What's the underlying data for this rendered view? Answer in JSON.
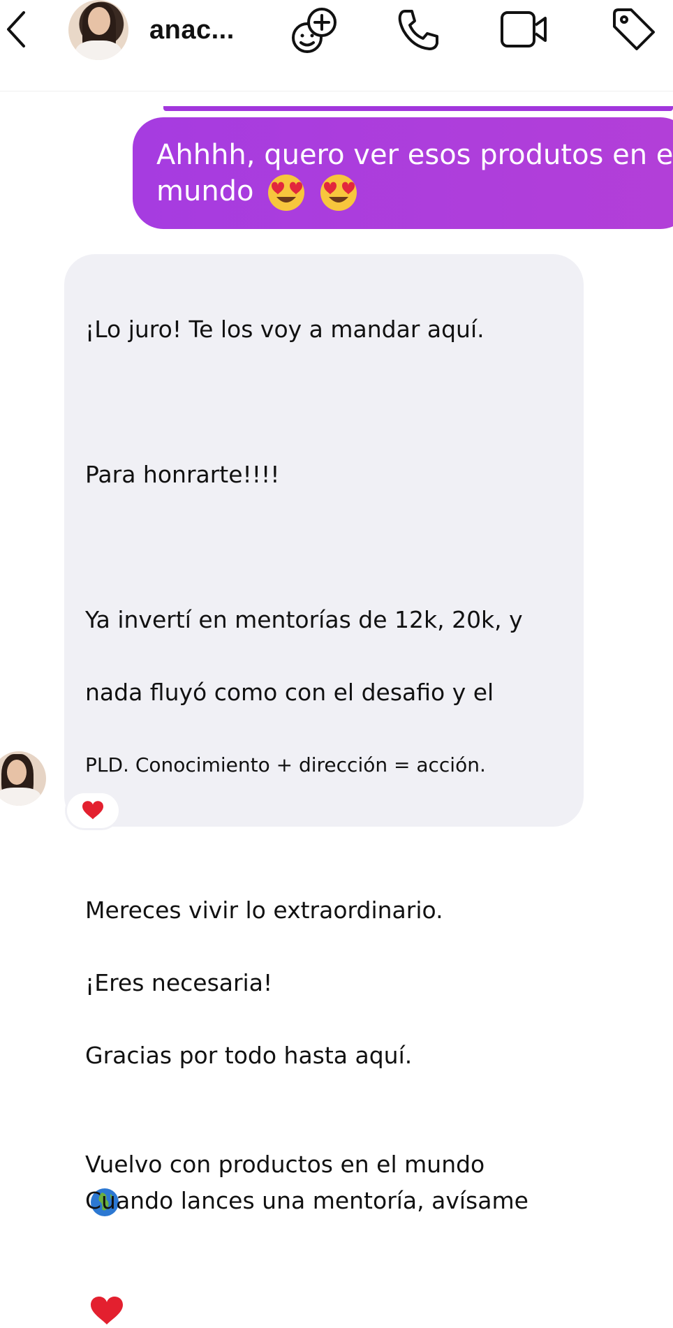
{
  "header": {
    "back_icon": "chevron-left-icon",
    "avatar": "profile-photo",
    "username": "anac...",
    "actions": [
      "effects-icon",
      "phone-icon",
      "video-icon",
      "tag-icon"
    ]
  },
  "messages": [
    {
      "direction": "outgoing",
      "text": "Ahhhh, quero ver esos produtos en el mundo",
      "emojis": [
        "heart-eyes",
        "heart-eyes"
      ]
    },
    {
      "direction": "incoming",
      "lines": [
        "¡Lo juro! Te los voy a mandar aquí.",
        "",
        "Para honrarte!!!!",
        "",
        "Ya invertí en mentorías de 12k, 20k, y",
        "nada fluyó como con el desafio y el",
        "PLD. Conocimiento + dirección = acción.",
        "",
        "Mereces vivir lo extraordinario.",
        "¡Eres necesaria!",
        "Gracias por todo hasta aquí.",
        "Vuelvo con productos en el mundo",
        "Cuando lances una mentoría, avísame"
      ],
      "emojis": [
        "globe-icon",
        "red-heart-icon"
      ],
      "reaction": "red-heart-icon"
    }
  ],
  "colors": {
    "outgoing_bubble": "#a63ce0",
    "incoming_bubble": "#f0f0f5",
    "text_dark": "#111111",
    "text_light": "#ffffff"
  }
}
